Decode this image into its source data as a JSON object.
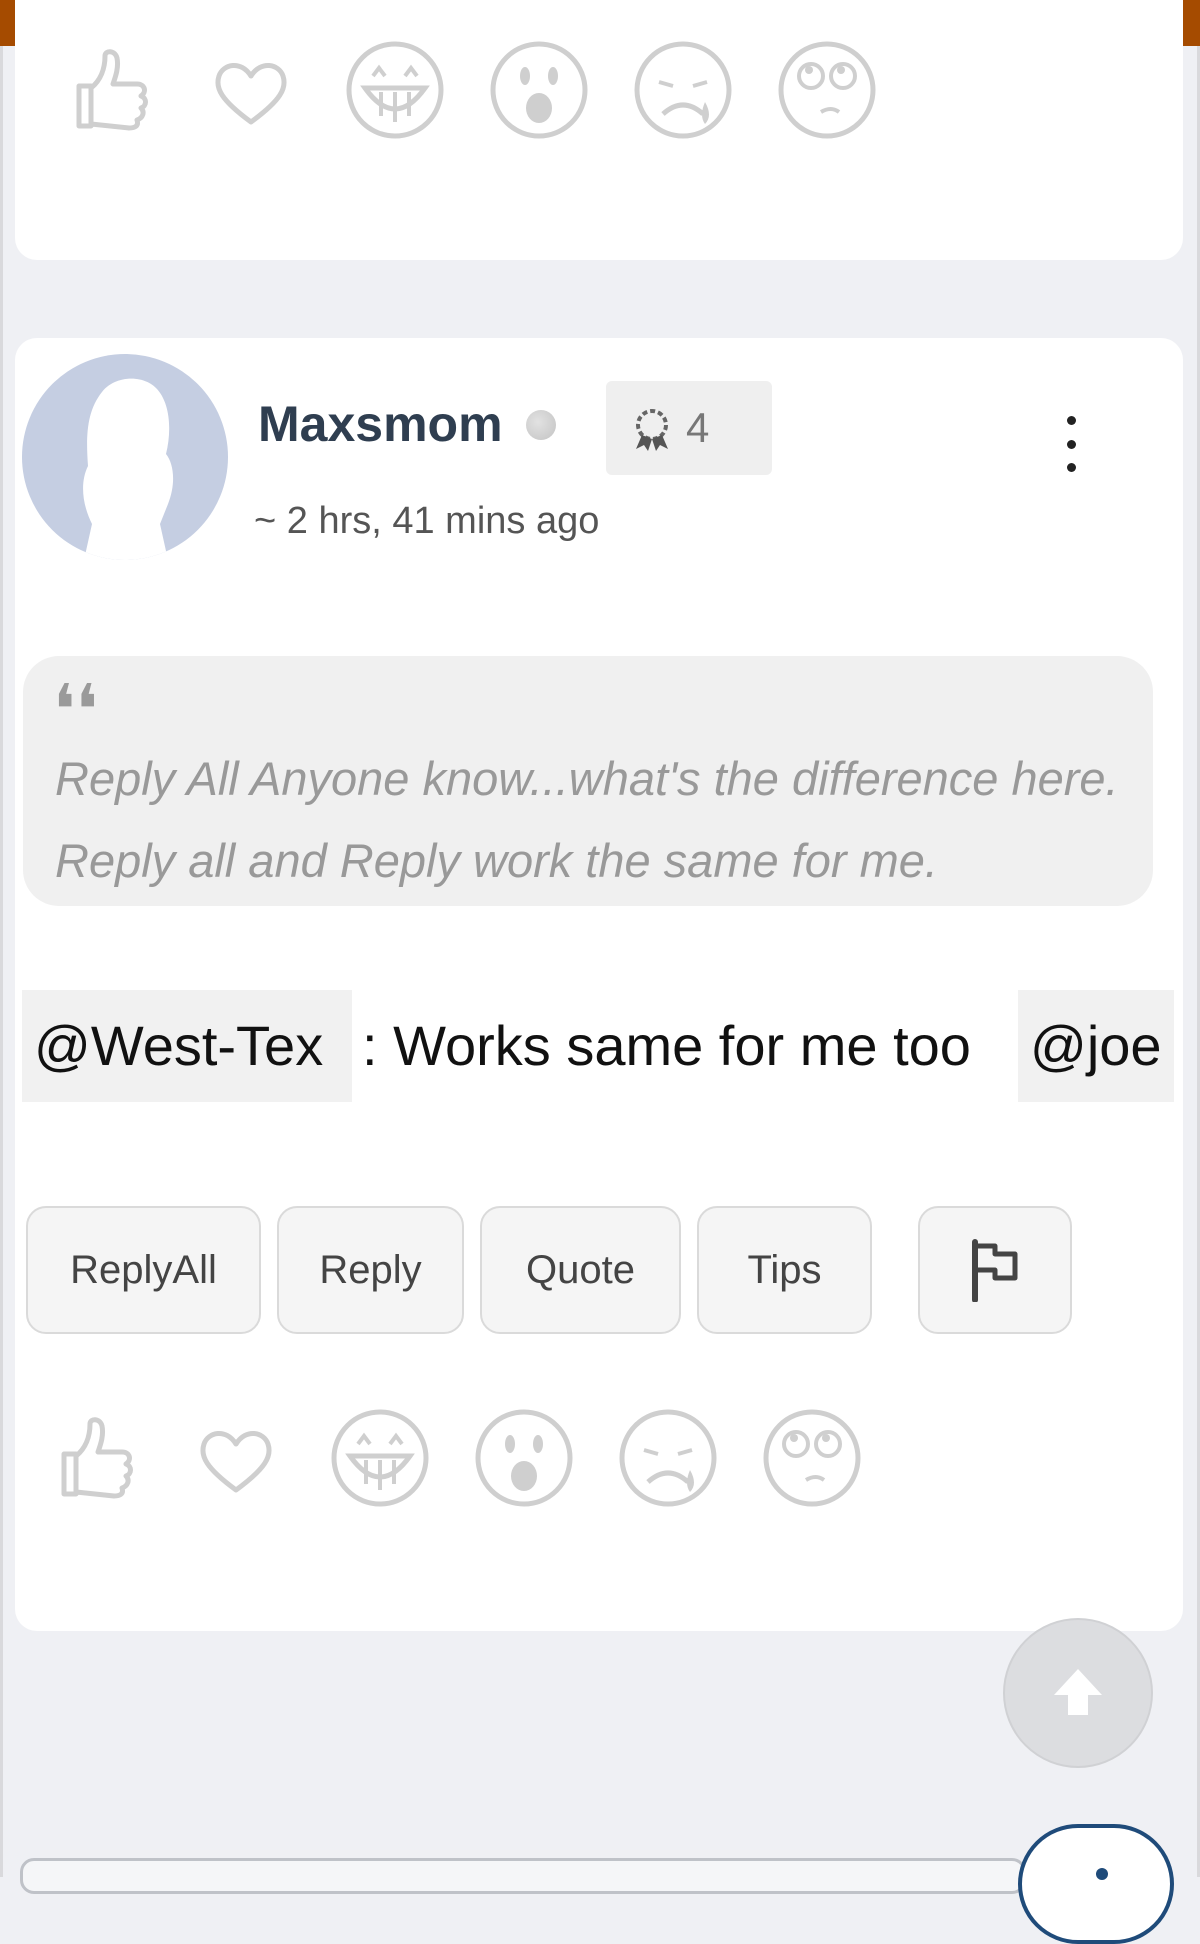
{
  "app": {
    "accent_color": "#a54b00"
  },
  "reaction_icons": [
    {
      "name": "thumbs-up-icon"
    },
    {
      "name": "heart-icon"
    },
    {
      "name": "grin-icon"
    },
    {
      "name": "wow-icon"
    },
    {
      "name": "sad-icon"
    },
    {
      "name": "eye-roll-icon"
    }
  ],
  "post": {
    "author": "Maxsmom",
    "rank": "4",
    "timestamp": "~ 2 hrs, 41 mins ago",
    "quote_mark": "❛❛",
    "quote": "Reply All Anyone know...what's the difference here. Reply all and Reply work the same for me.",
    "mention_1": "@West-Tex",
    "message": ": Works same for me too",
    "mention_2": "@joe",
    "buttons": {
      "reply_all": "ReplyAll",
      "reply": "Reply",
      "quote": "Quote",
      "tips": "Tips"
    }
  }
}
